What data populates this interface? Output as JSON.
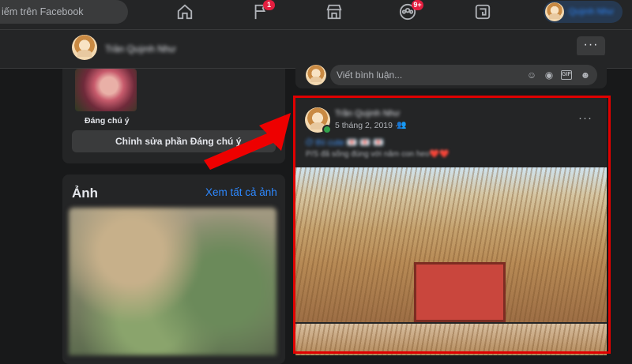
{
  "topbar": {
    "search_placeholder": "iếm trên Facebook",
    "badges": {
      "flag": "1",
      "groups": "9+"
    },
    "profile_name": "Quỳnh Như"
  },
  "profile_header": {
    "name": "Trần Quỳnh Như",
    "more_label": "···"
  },
  "featured": {
    "label": "Đáng chú ý",
    "edit_button": "Chỉnh sửa phần Đáng chú ý"
  },
  "photos": {
    "title": "Ảnh",
    "see_all": "Xem tất cả ảnh"
  },
  "comment": {
    "placeholder": "Viết bình luận..."
  },
  "post": {
    "author": "Trần Quỳnh Như",
    "date": "5 tháng 2, 2019 ·",
    "more_label": "···",
    "caption_line1": "Ờ thì cute 💌 💌 💌",
    "caption_line2": "P/S đã sống đúng với năm con heo❤️❤️"
  },
  "colors": {
    "background": "#18191a",
    "card": "#242526",
    "accent": "#2d88ff",
    "highlight": "#e00000",
    "badge": "#e41e3f"
  },
  "icons": [
    "home-icon",
    "flag-icon",
    "store-icon",
    "groups-icon",
    "gaming-icon",
    "emoji-icon",
    "camera-icon",
    "gif-icon",
    "sticker-icon",
    "audience-friends-icon",
    "red-arrow-annotation"
  ]
}
